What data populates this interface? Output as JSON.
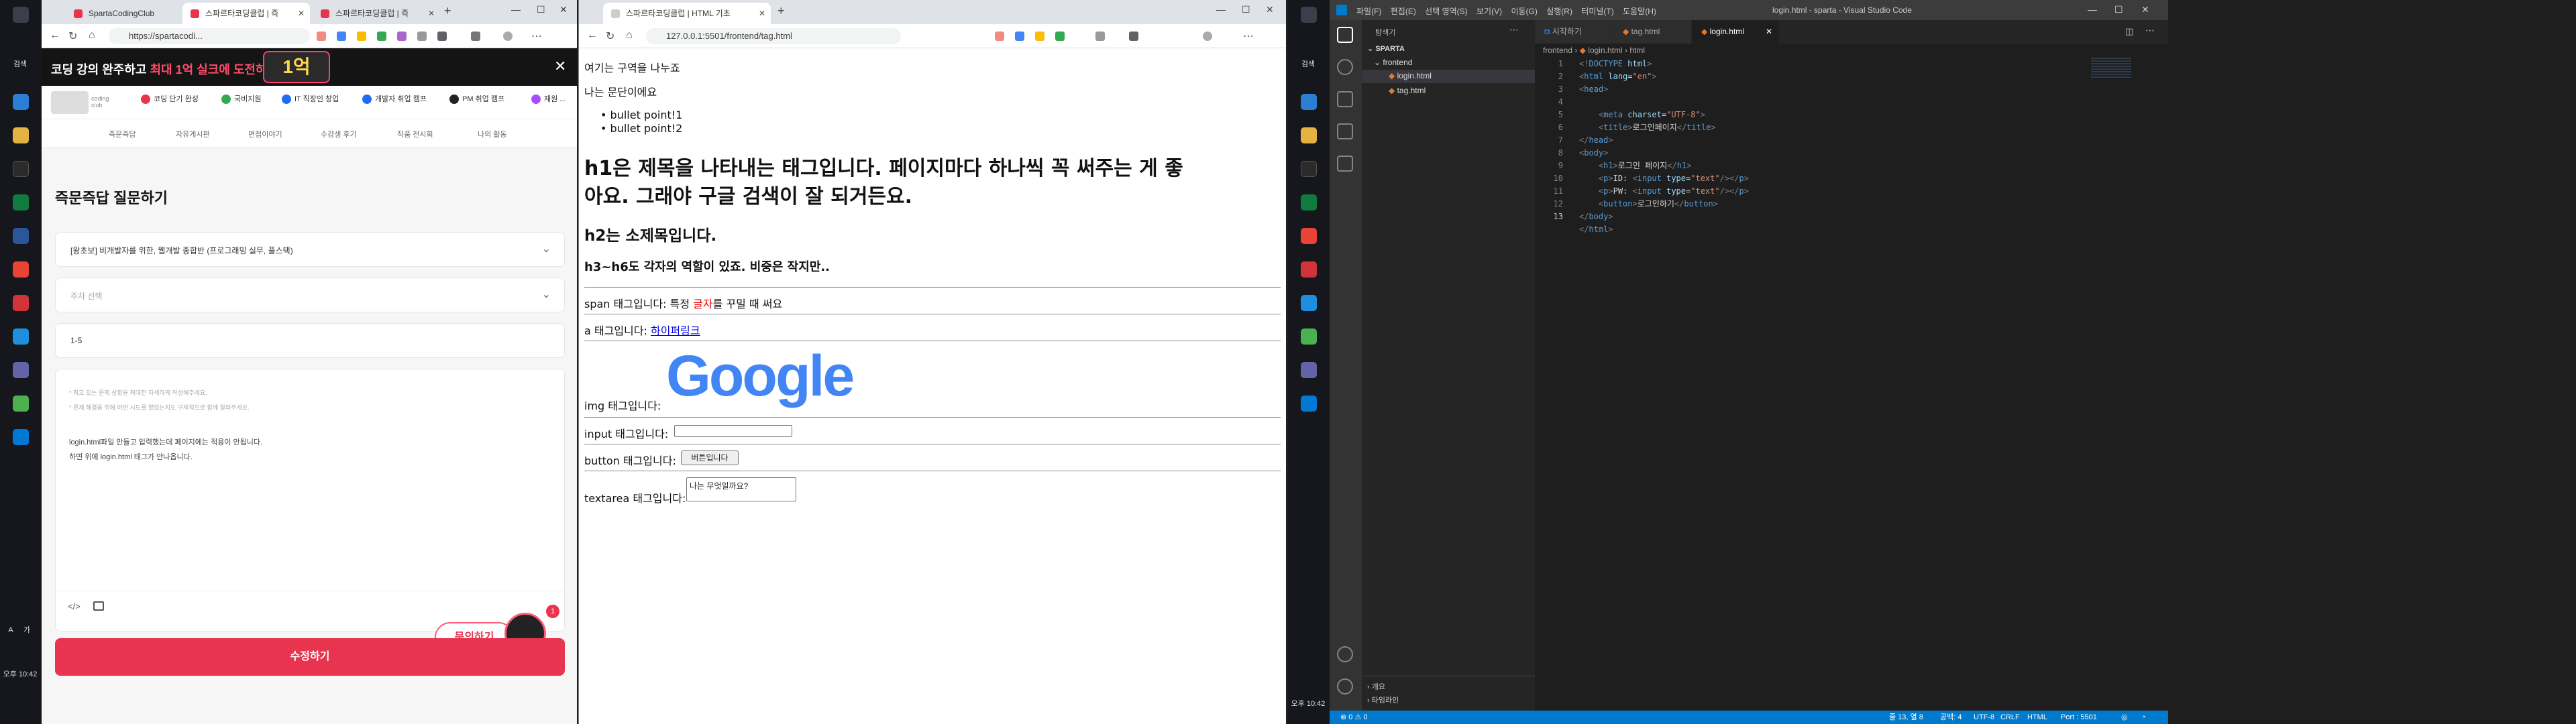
{
  "taskbar": {
    "search_label": "검색",
    "time": "오후 10:42",
    "input_label": "A",
    "mode_label": "가"
  },
  "browser1": {
    "tabs": [
      {
        "label": "SpartaCodingClub"
      },
      {
        "label": "스파르타코딩클럽 | 즉"
      },
      {
        "label": "스파르타코딩클럽 | 즉"
      }
    ],
    "url": "https://spartacodi...",
    "banner": {
      "text_prefix": "코딩 강의 완주하고",
      "text_highlight": "최대 1억 실크에 도전하세요",
      "arrow": "›",
      "prize": "1억"
    },
    "logo": "coding club",
    "nav_pills": [
      "코딩 단기 완성",
      "국비지원",
      "IT 직장인 창업",
      "개발자 취업 캠프",
      "PM 취업 캠프",
      "재원 ..."
    ],
    "menu": [
      "즉문즉답",
      "자유게시판",
      "면접이야기",
      "수강생 후기",
      "작품 전시회",
      "나의 활동"
    ],
    "heading": "즉문즉답 질문하기",
    "course_select": "[왕초보] 비개발자를 위한, 웹개발 종합반 (프로그래밍 실무, 풀스택)",
    "week_placeholder": "주차 선택",
    "chapter_value": "1-5",
    "hint1": "* 최고 있는 문제 상황을 최대한 자세하게 작성해주세요.",
    "hint2": "* 문제 해결을 위해 어떤 시도를 했었는지도 구체적으로 함께 알려주세요.",
    "body1": "login.html파일 만들고 입력했는데 페이지에는 적용이 안됩니다.",
    "body2": "하면 위에 login.html 태그가 안나옵니다.",
    "ask_button": "문의하기",
    "badge": "1",
    "submit": "수정하기"
  },
  "browser2": {
    "tab": "스파르타코딩클럽 | HTML 기초",
    "url": "127.0.0.1:5501/frontend/tag.html",
    "lines": {
      "div": "여기는 구역을 나누죠",
      "p": "나는 문단이에요",
      "li1": "bullet point!1",
      "li2": "bullet point!2",
      "h1a": "h1은 제목을 나타내는 태그입니다. 페이지마다 하나씩 꼭 써주는 게 좋",
      "h1b": "아요. 그래야 구글 검색이 잘 되거든요.",
      "h2": "h2는 소제목입니다.",
      "h3": "h3~h6도 각자의 역할이 있죠. 비중은 작지만..",
      "span_pre": "span 태그입니다: 특정",
      "span_red": "글자",
      "span_post": "를 꾸밀 때 써요",
      "a_pre": "a 태그입니다:",
      "a_link": "하이퍼링크",
      "img": "img 태그입니다:",
      "google": "Google",
      "input": "input 태그입니다:",
      "button_label": "button 태그입니다:",
      "button": "버튼입니다",
      "textarea_label": "textarea 태그입니다:",
      "textarea": "나는 무엇일까요?"
    }
  },
  "vscode": {
    "menu": [
      "파일(F)",
      "편집(E)",
      "선택 영역(S)",
      "보기(V)",
      "이동(G)",
      "실행(R)",
      "터미널(T)",
      "도움말(H)"
    ],
    "title": "login.html - sparta - Visual Studio Code",
    "explorer_title": "탐색기",
    "tabs": [
      "시작하기",
      "tag.html",
      "login.html"
    ],
    "tree": {
      "root": "SPARTA",
      "folder": "frontend",
      "files": [
        "login.html",
        "tag.html"
      ]
    },
    "breadcrumb": [
      "frontend",
      "login.html",
      "html"
    ],
    "outline": "개요",
    "timeline": "타임라인",
    "status": {
      "left": "⊗ 0 ⚠ 0",
      "pos": "줄 13, 열 8",
      "spaces": "공백: 4",
      "enc": "UTF-8",
      "eol": "CRLF",
      "lang": "HTML",
      "port": "Port : 5501"
    }
  }
}
